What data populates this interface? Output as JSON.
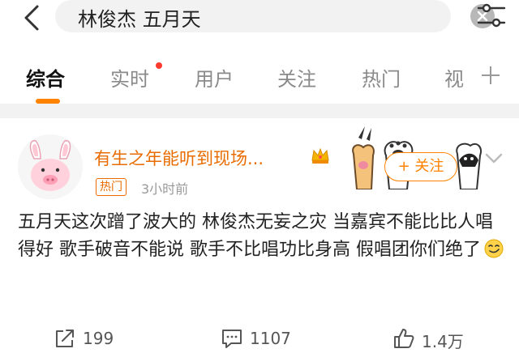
{
  "search": {
    "query": "林俊杰 五月天"
  },
  "tabs": [
    {
      "label": "综合"
    },
    {
      "label": "实时"
    },
    {
      "label": "用户"
    },
    {
      "label": "关注"
    },
    {
      "label": "热门"
    },
    {
      "label": "视"
    }
  ],
  "post": {
    "username": "有生之年能听到现场...",
    "badge": "热门",
    "time": "3小时前",
    "follow_label": "+ 关注",
    "text": "五月天这次蹭了波大的 林俊杰无妄之灾 当嘉宾不能比比人唱得好 歌手破音不能说 歌手不比唱功比身高 假唱团你们绝了"
  },
  "actions": {
    "repost": "199",
    "comment": "1107",
    "like": "1.4万"
  },
  "colors": {
    "accent": "#ff8200",
    "username": "#e86c00",
    "notification_dot": "#ff3b30"
  },
  "icons": [
    "back-arrow-icon",
    "clear-icon",
    "filter-icon",
    "plus-icon",
    "crown-icon",
    "chevron-down-icon",
    "repost-icon",
    "comment-icon",
    "like-icon"
  ]
}
